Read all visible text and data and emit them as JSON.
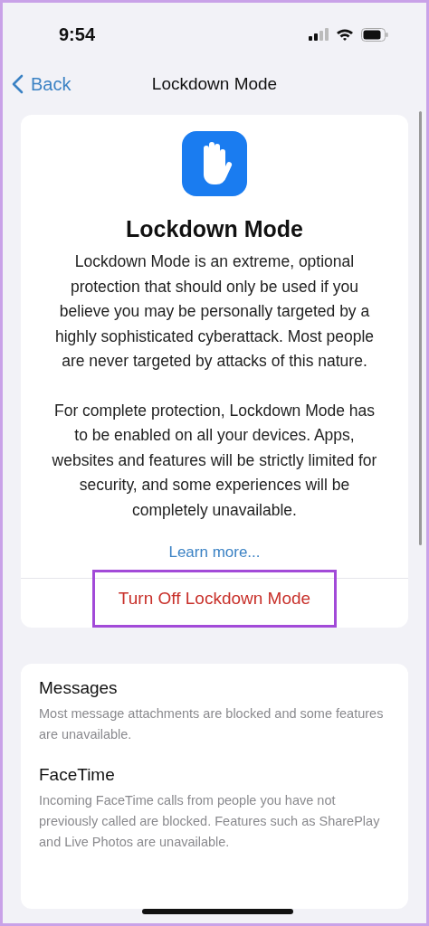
{
  "status_bar": {
    "time": "9:54"
  },
  "nav": {
    "back": "Back",
    "title": "Lockdown Mode"
  },
  "intro": {
    "title": "Lockdown Mode",
    "paragraphs": [
      "Lockdown Mode is an extreme, optional protection that should only be used if you believe you may be personally targeted by a highly sophisticated cyberattack. Most people are never targeted by attacks of this nature.",
      "For complete protection, Lockdown Mode has to be enabled on all your devices. Apps, websites and features will be strictly limited for security, and some experiences will be completely unavailable."
    ],
    "link": "Learn more...",
    "action": {
      "label": "Turn Off Lockdown Mode",
      "highlighted": true
    }
  },
  "features": [
    {
      "title": "Messages",
      "description": "Most message attachments are blocked and some features are unavailable."
    },
    {
      "title": "FaceTime",
      "description": "Incoming FaceTime calls from people you have not previously called are blocked. Features such as SharePlay and Live Photos are unavailable."
    }
  ]
}
